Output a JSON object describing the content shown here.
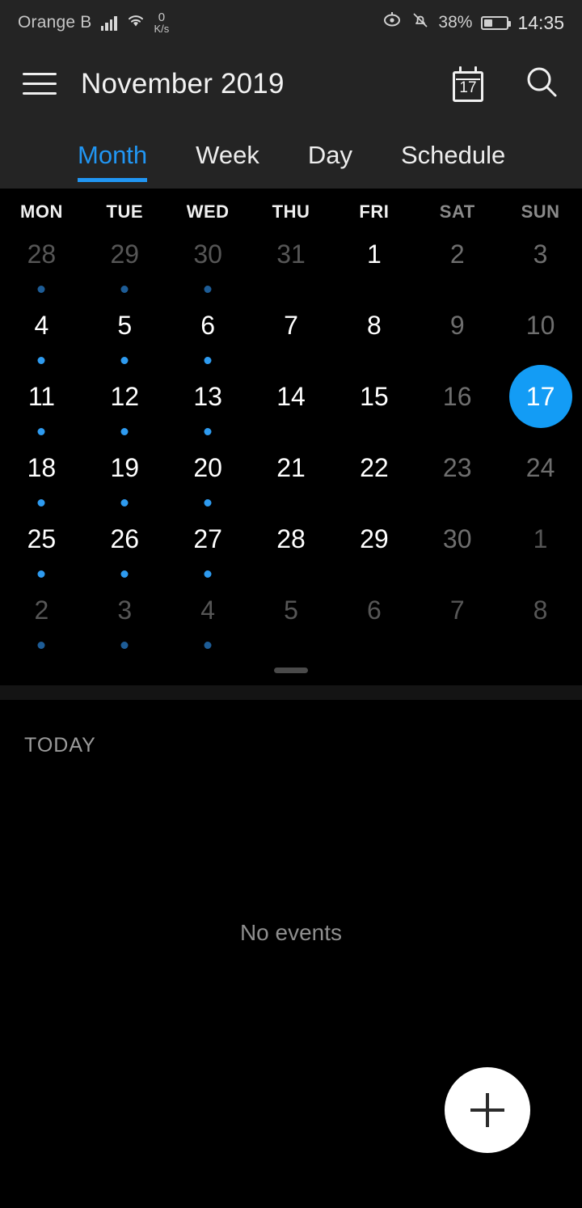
{
  "status_bar": {
    "carrier": "Orange B",
    "signal_icon": "cellular-signal-icon",
    "wifi_icon": "wifi-icon",
    "net_speed_value": "0",
    "net_speed_unit": "K/s",
    "eye_comfort_icon": "eye-comfort-icon",
    "mute_icon": "bell-muted-icon",
    "battery_percent": "38%",
    "battery_icon": "battery-icon",
    "clock": "14:35"
  },
  "app_bar": {
    "menu_icon": "hamburger-menu-icon",
    "title": "November 2019",
    "today_icon": "calendar-today-icon",
    "today_icon_day": "17",
    "search_icon": "search-icon"
  },
  "tabs": [
    {
      "label": "Month",
      "active": true
    },
    {
      "label": "Week",
      "active": false
    },
    {
      "label": "Day",
      "active": false
    },
    {
      "label": "Schedule",
      "active": false
    }
  ],
  "weekdays": [
    {
      "label": "MON",
      "weekend": false
    },
    {
      "label": "TUE",
      "weekend": false
    },
    {
      "label": "WED",
      "weekend": false
    },
    {
      "label": "THU",
      "weekend": false
    },
    {
      "label": "FRI",
      "weekend": false
    },
    {
      "label": "SAT",
      "weekend": true
    },
    {
      "label": "SUN",
      "weekend": true
    }
  ],
  "calendar": {
    "weeks": [
      [
        {
          "day": "28",
          "state": "other-month",
          "dot": "dim"
        },
        {
          "day": "29",
          "state": "other-month",
          "dot": "dim"
        },
        {
          "day": "30",
          "state": "other-month",
          "dot": "dim"
        },
        {
          "day": "31",
          "state": "other-month",
          "dot": "none"
        },
        {
          "day": "1",
          "state": "current",
          "dot": "none"
        },
        {
          "day": "2",
          "state": "weekend",
          "dot": "none"
        },
        {
          "day": "3",
          "state": "weekend",
          "dot": "none"
        }
      ],
      [
        {
          "day": "4",
          "state": "current",
          "dot": "bright"
        },
        {
          "day": "5",
          "state": "current",
          "dot": "bright"
        },
        {
          "day": "6",
          "state": "current",
          "dot": "bright"
        },
        {
          "day": "7",
          "state": "current",
          "dot": "none"
        },
        {
          "day": "8",
          "state": "current",
          "dot": "none"
        },
        {
          "day": "9",
          "state": "weekend",
          "dot": "none"
        },
        {
          "day": "10",
          "state": "weekend",
          "dot": "none"
        }
      ],
      [
        {
          "day": "11",
          "state": "current",
          "dot": "bright"
        },
        {
          "day": "12",
          "state": "current",
          "dot": "bright"
        },
        {
          "day": "13",
          "state": "current",
          "dot": "bright"
        },
        {
          "day": "14",
          "state": "current",
          "dot": "none"
        },
        {
          "day": "15",
          "state": "current",
          "dot": "none"
        },
        {
          "day": "16",
          "state": "weekend",
          "dot": "none"
        },
        {
          "day": "17",
          "state": "today",
          "dot": "none"
        }
      ],
      [
        {
          "day": "18",
          "state": "current",
          "dot": "bright"
        },
        {
          "day": "19",
          "state": "current",
          "dot": "bright"
        },
        {
          "day": "20",
          "state": "current",
          "dot": "bright"
        },
        {
          "day": "21",
          "state": "current",
          "dot": "none"
        },
        {
          "day": "22",
          "state": "current",
          "dot": "none"
        },
        {
          "day": "23",
          "state": "weekend",
          "dot": "none"
        },
        {
          "day": "24",
          "state": "weekend",
          "dot": "none"
        }
      ],
      [
        {
          "day": "25",
          "state": "current",
          "dot": "bright"
        },
        {
          "day": "26",
          "state": "current",
          "dot": "bright"
        },
        {
          "day": "27",
          "state": "current",
          "dot": "bright"
        },
        {
          "day": "28",
          "state": "current",
          "dot": "none"
        },
        {
          "day": "29",
          "state": "current",
          "dot": "none"
        },
        {
          "day": "30",
          "state": "weekend",
          "dot": "none"
        },
        {
          "day": "1",
          "state": "other-month",
          "dot": "none"
        }
      ],
      [
        {
          "day": "2",
          "state": "other-month",
          "dot": "dim"
        },
        {
          "day": "3",
          "state": "other-month",
          "dot": "dim"
        },
        {
          "day": "4",
          "state": "other-month",
          "dot": "dim"
        },
        {
          "day": "5",
          "state": "other-month",
          "dot": "none"
        },
        {
          "day": "6",
          "state": "other-month",
          "dot": "none"
        },
        {
          "day": "7",
          "state": "other-month",
          "dot": "none"
        },
        {
          "day": "8",
          "state": "other-month",
          "dot": "none"
        }
      ]
    ],
    "drag_handle": "sheet-drag-handle"
  },
  "events_panel": {
    "section_label": "TODAY",
    "empty_message": "No events",
    "add_event_icon": "plus-icon"
  },
  "colors": {
    "accent": "#2196f3",
    "today_circle": "#139cf5",
    "event_dot": "#2e9bf0",
    "event_dot_dim": "#1d5c96",
    "appbar_bg": "#242424",
    "page_bg": "#000000",
    "fab_bg": "#ffffff"
  }
}
